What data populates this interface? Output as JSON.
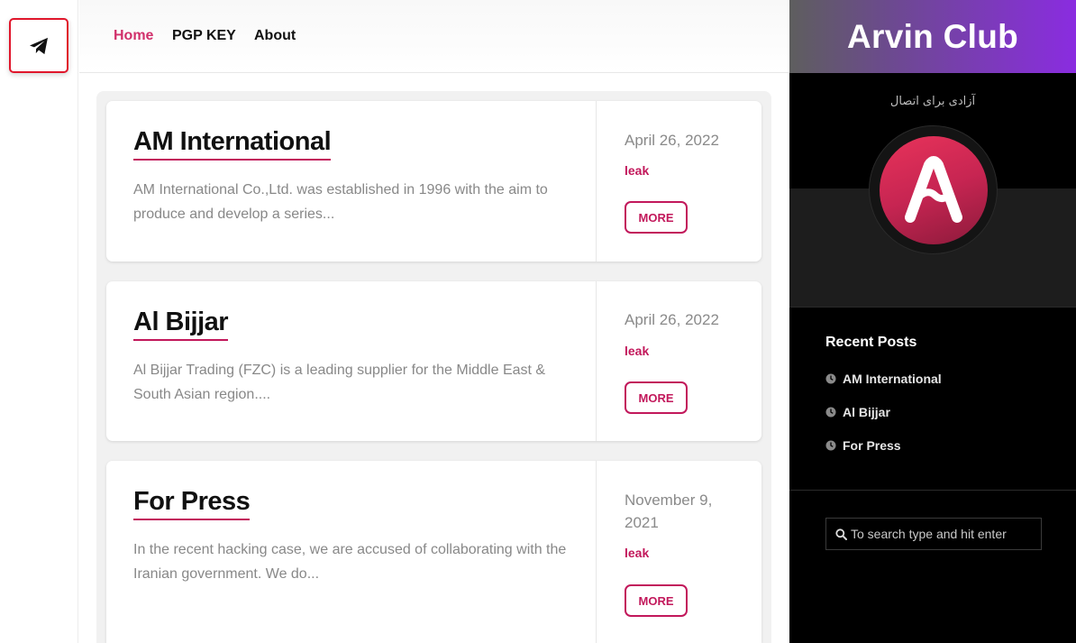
{
  "left_rail": {
    "telegram_button_icon": "telegram-plane-icon"
  },
  "nav": {
    "items": [
      {
        "label": "Home",
        "active": true
      },
      {
        "label": "PGP KEY",
        "active": false
      },
      {
        "label": "About",
        "active": false
      }
    ]
  },
  "posts": [
    {
      "title": "AM International",
      "excerpt": "AM International Co.,Ltd. was established in 1996 with the aim to produce and develop a series...",
      "date": "April 26, 2022",
      "category": "leak",
      "more_label": "MORE"
    },
    {
      "title": "Al Bijjar",
      "excerpt": "Al Bijjar Trading (FZC) is a leading supplier for the Middle East & South Asian region....",
      "date": "April 26, 2022",
      "category": "leak",
      "more_label": "MORE"
    },
    {
      "title": "For Press",
      "excerpt": "In the recent hacking case, we are accused of collaborating with the Iranian government. We do...",
      "date": "November 9, 2021",
      "category": "leak",
      "more_label": "MORE"
    }
  ],
  "sidebar": {
    "brand_title": "Arvin Club",
    "tagline": "آزادی برای اتصال",
    "avatar_letter": "A",
    "recent_heading": "Recent Posts",
    "recent_posts": [
      "AM International",
      "Al Bijjar",
      "For Press"
    ],
    "search_placeholder": "To search type and hit enter"
  },
  "colors": {
    "accent": "#c2185b",
    "nav_active": "#d1306b",
    "brand_gradient_end": "#8a2ce0",
    "telegram_highlight": "#e0162b"
  }
}
